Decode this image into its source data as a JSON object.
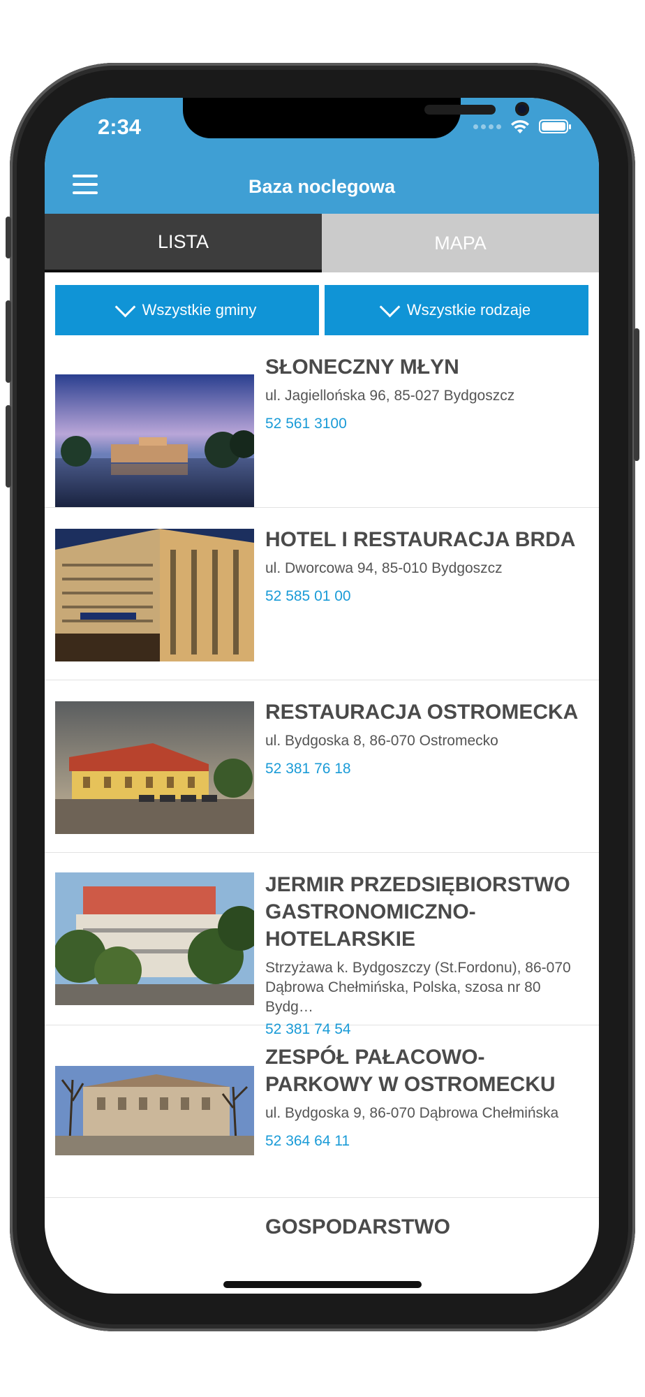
{
  "status": {
    "time": "2:34"
  },
  "header": {
    "title": "Baza noclegowa"
  },
  "tabs": [
    {
      "label": "LISTA"
    },
    {
      "label": "MAPA"
    }
  ],
  "filters": [
    {
      "label": "Wszystkie gminy"
    },
    {
      "label": "Wszystkie rodzaje"
    }
  ],
  "items": [
    {
      "name": "SŁONECZNY MŁYN",
      "address": "ul. Jagiellońska 96, 85-027 Bydgoszcz",
      "phone": "52 561 3100"
    },
    {
      "name": "HOTEL I RESTAURACJA BRDA",
      "address": "ul. Dworcowa 94, 85-010 Bydgoszcz",
      "phone": "52 585 01 00"
    },
    {
      "name": "RESTAURACJA OSTROMECKA",
      "address": "ul. Bydgoska 8, 86-070 Ostromecko",
      "phone": "52 381 76 18"
    },
    {
      "name": "JERMIR PRZEDSIĘBIORSTWO GASTRONOMICZNO-HOTELARSKIE",
      "address": "Strzyżawa k. Bydgoszczy (St.Fordonu), 86-070 Dąbrowa Chełmińska, Polska, szosa nr 80 Bydg…",
      "phone": "52 381 74 54"
    },
    {
      "name": "ZESPÓŁ PAŁACOWO-PARKOWY W OSTROMECKU",
      "address": "ul. Bydgoska 9, 86-070 Dąbrowa Chełmińska",
      "phone": "52 364 64 11"
    }
  ],
  "last_item": {
    "name": "GOSPODARSTWO"
  },
  "colors": {
    "header": "#3f9fd4",
    "filter": "#1094d6",
    "phone_link": "#1a9bd7"
  }
}
